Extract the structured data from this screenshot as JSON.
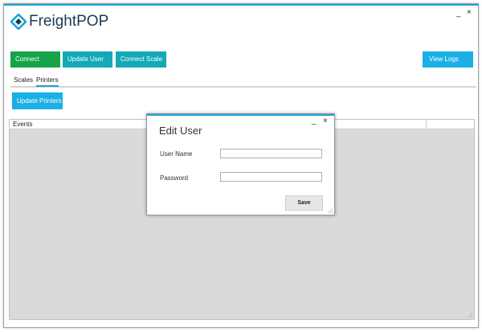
{
  "app": {
    "logo_text": "FreightPOP",
    "brand_colors": {
      "accent": "#1aa3d9",
      "logo_dark": "#1b3a57"
    },
    "window_controls": {
      "minimize": "_",
      "close": "×"
    }
  },
  "toolbar": {
    "connect_label": "Connect",
    "update_user_label": "Update User",
    "connect_scale_label": "Connect Scale",
    "view_logs_label": "View Logs"
  },
  "tabs": [
    {
      "label": "Scales",
      "active": false
    },
    {
      "label": "Printers",
      "active": true
    }
  ],
  "printers": {
    "update_printers_label": "Update Printers"
  },
  "events": {
    "header_label": "Events"
  },
  "dialog": {
    "title": "Edit User",
    "window_controls": {
      "minimize": "_",
      "close": "×"
    },
    "username_label": "User Name",
    "username_value": "",
    "password_label": "Password",
    "password_value": "",
    "save_label": "Save"
  }
}
